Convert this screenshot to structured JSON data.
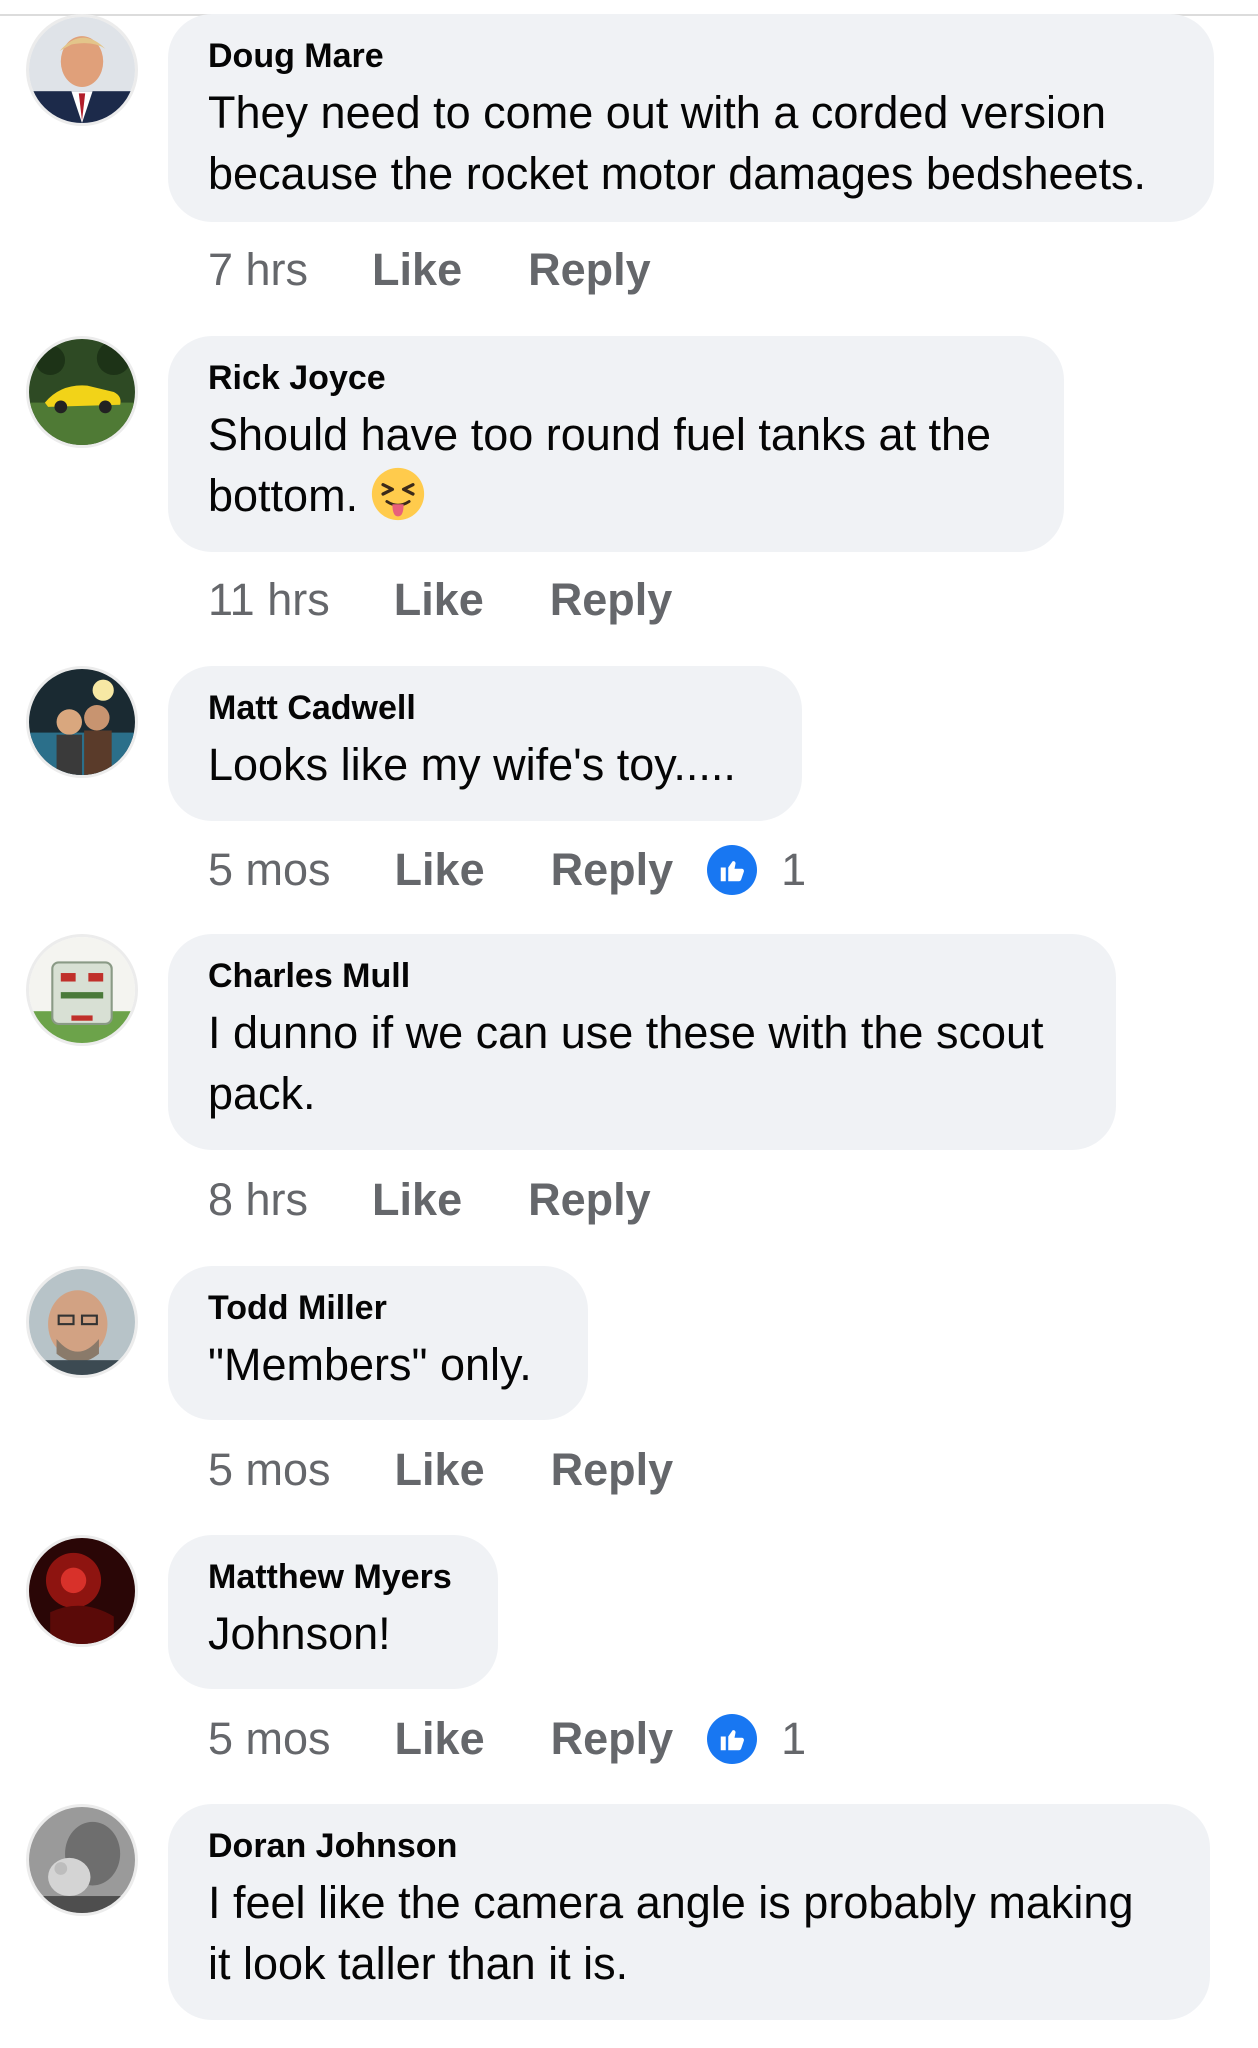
{
  "comments": [
    {
      "author": "Doug Mare",
      "lines": [
        "They need to come out with a corded version",
        "because the rocket motor damages bedsheets."
      ],
      "time": "7 hrs",
      "like_label": "Like",
      "reply_label": "Reply",
      "reactions": null,
      "emoji": null
    },
    {
      "author": "Rick Joyce",
      "lines": [
        "Should have too round fuel tanks at the",
        "bottom."
      ],
      "time": "11 hrs",
      "like_label": "Like",
      "reply_label": "Reply",
      "reactions": null,
      "emoji": "squinting-face-with-tongue"
    },
    {
      "author": "Matt Cadwell",
      "lines": [
        "Looks like my wife's toy....."
      ],
      "time": "5 mos",
      "like_label": "Like",
      "reply_label": "Reply",
      "reactions": "1",
      "emoji": null
    },
    {
      "author": "Charles Mull",
      "lines": [
        "I dunno if we can use these with the scout",
        "pack."
      ],
      "time": "8 hrs",
      "like_label": "Like",
      "reply_label": "Reply",
      "reactions": null,
      "emoji": null
    },
    {
      "author": "Todd Miller",
      "lines": [
        "\"Members\" only."
      ],
      "time": "5 mos",
      "like_label": "Like",
      "reply_label": "Reply",
      "reactions": null,
      "emoji": null
    },
    {
      "author": "Matthew Myers",
      "lines": [
        "Johnson!"
      ],
      "time": "5 mos",
      "like_label": "Like",
      "reply_label": "Reply",
      "reactions": "1",
      "emoji": null
    },
    {
      "author": "Doran Johnson",
      "lines": [
        "I feel like the camera angle is probably making",
        "it look taller than it is."
      ],
      "time": "",
      "like_label": "",
      "reply_label": "",
      "reactions": null,
      "emoji": null
    }
  ],
  "colors": {
    "bubble_bg": "#f0f2f5",
    "meta_text": "#65676b",
    "like_blue": "#1877f2"
  },
  "icons": {
    "reaction": "like-thumbs-up-icon",
    "emoji": "squinting-face-with-tongue-icon"
  }
}
